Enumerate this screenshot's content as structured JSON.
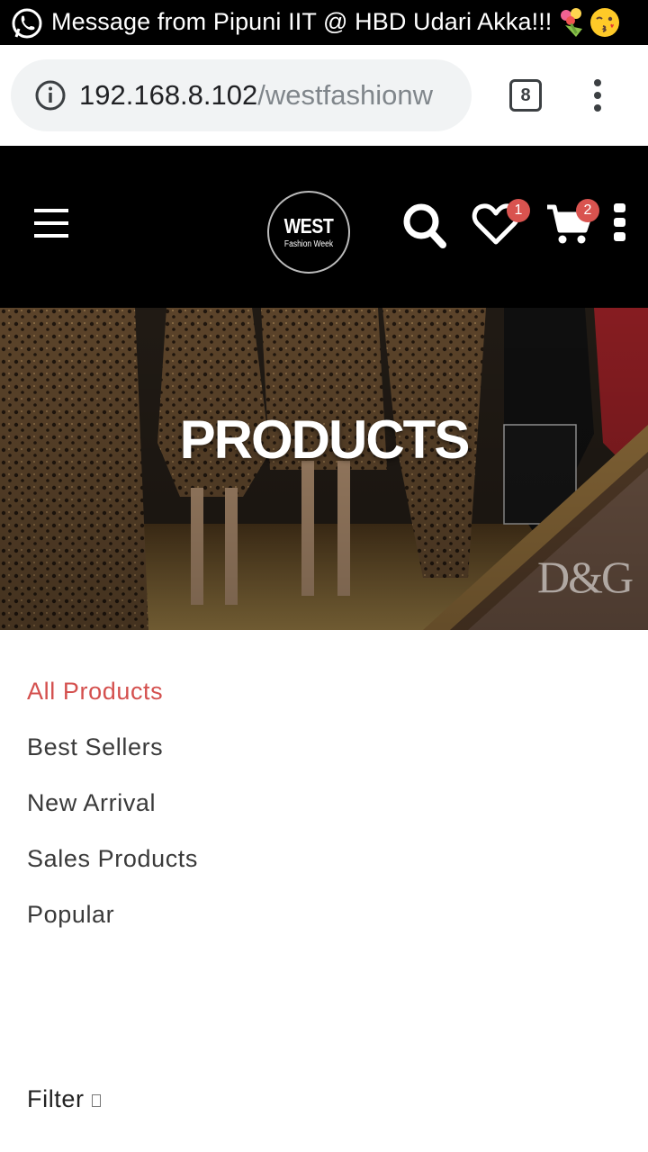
{
  "notification": {
    "text": "Message from Pipuni IIT @ HBD Udari Akka!!!",
    "app_icon": "whatsapp-icon",
    "emojis": [
      "bouquet-emoji",
      "kissing-face-emoji"
    ]
  },
  "browser": {
    "url_host": "192.168.8.102",
    "url_path": "/westfashionw",
    "tab_count": "8"
  },
  "header": {
    "logo_line1": "WEST",
    "logo_line2": "Fashion Week",
    "wishlist_count": "1",
    "cart_count": "2"
  },
  "hero": {
    "title": "PRODUCTS",
    "brand_mark": "D&G"
  },
  "categories": [
    {
      "label": "All Products",
      "active": true
    },
    {
      "label": "Best Sellers",
      "active": false
    },
    {
      "label": "New Arrival",
      "active": false
    },
    {
      "label": "Sales Products",
      "active": false
    },
    {
      "label": "Popular",
      "active": false
    }
  ],
  "filter": {
    "label": "Filter"
  },
  "colors": {
    "accent": "#d4504e",
    "header_bg": "#000000",
    "badge": "#d9534f"
  }
}
